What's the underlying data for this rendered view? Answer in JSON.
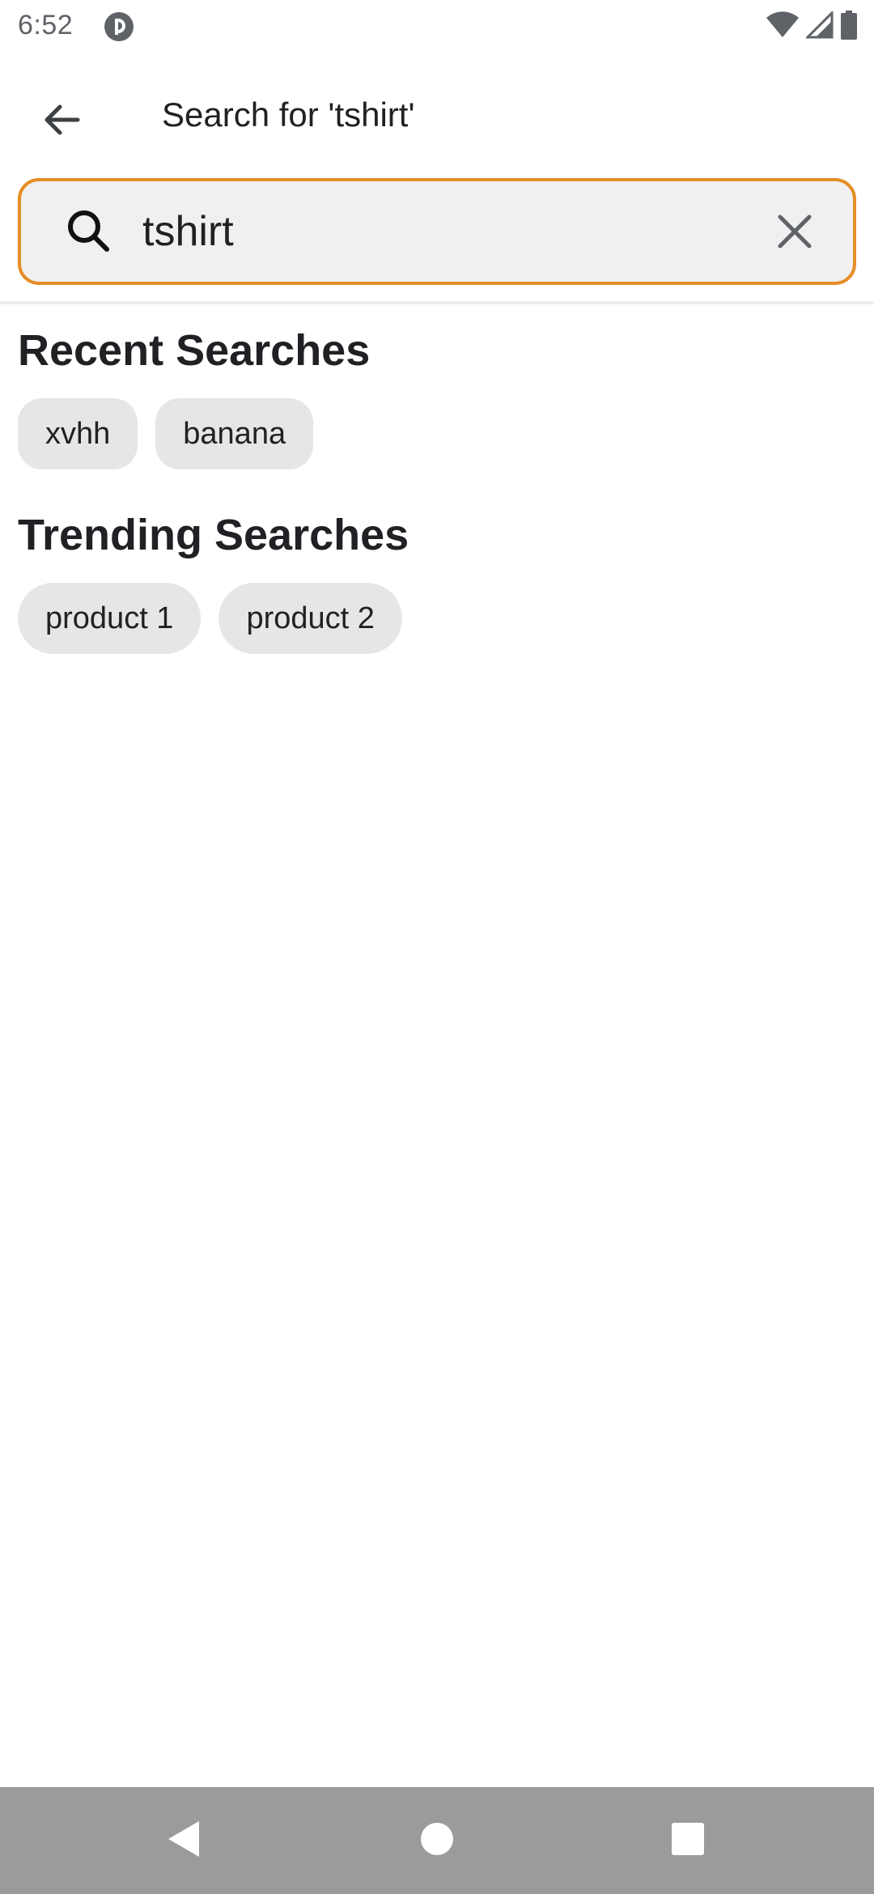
{
  "status_bar": {
    "time": "6:52",
    "app_icon": "pocket-casts-like-icon",
    "icons": [
      "wifi-icon",
      "signal-icon",
      "battery-icon"
    ]
  },
  "app_bar": {
    "back_icon": "arrow-back-icon",
    "title": "Search for 'tshirt'"
  },
  "search": {
    "value": "tshirt",
    "search_icon": "search-icon",
    "clear_icon": "close-icon",
    "accent_color": "#e58e26"
  },
  "recent": {
    "title": "Recent Searches",
    "items": [
      {
        "label": "xvhh"
      },
      {
        "label": "banana"
      }
    ]
  },
  "trending": {
    "title": "Trending Searches",
    "items": [
      {
        "label": "product 1"
      },
      {
        "label": "product 2"
      }
    ]
  },
  "nav_bar": {
    "icons": [
      "back-triangle-icon",
      "home-circle-icon",
      "recents-square-icon"
    ]
  }
}
